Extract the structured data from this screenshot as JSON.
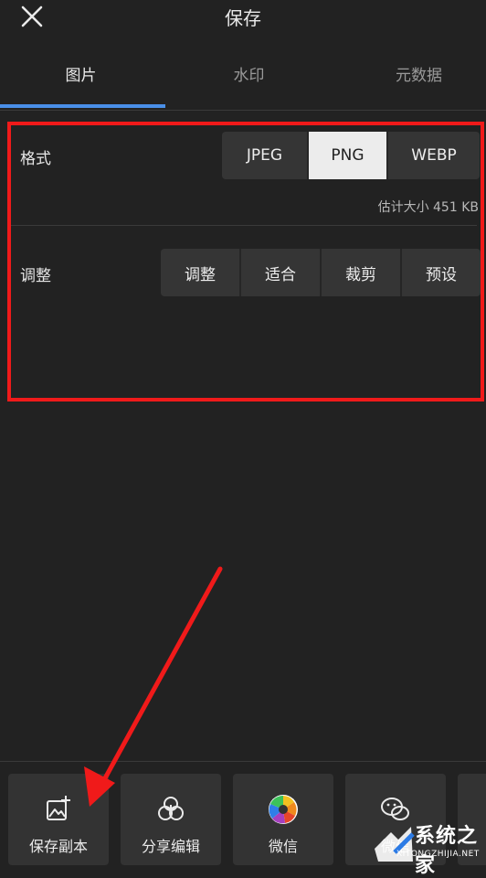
{
  "header": {
    "title": "保存",
    "close_icon": "close-icon"
  },
  "tabs": [
    {
      "label": "图片",
      "active": true
    },
    {
      "label": "水印",
      "active": false
    },
    {
      "label": "元数据",
      "active": false
    }
  ],
  "format": {
    "label": "格式",
    "options": [
      "JPEG",
      "PNG",
      "WEBP"
    ],
    "selected": "PNG",
    "estimated_size": "估计大小 451 KB"
  },
  "adjust": {
    "label": "调整",
    "options": [
      "调整",
      "适合",
      "裁剪",
      "预设"
    ]
  },
  "share_targets": [
    {
      "label": "保存副本",
      "icon": "save-copy-icon"
    },
    {
      "label": "分享编辑",
      "icon": "share-edit-icon"
    },
    {
      "label": "微信",
      "icon": "wechat-moments-icon"
    },
    {
      "label": "微信",
      "icon": "wechat-icon"
    }
  ],
  "annotations": {
    "highlight_color": "#f01a1a",
    "arrow_color": "#f01a1a"
  },
  "accent_color": "#4a8fe8",
  "watermark": {
    "text": "系统之家",
    "sub": "XITONGZHIJIA.NET"
  }
}
